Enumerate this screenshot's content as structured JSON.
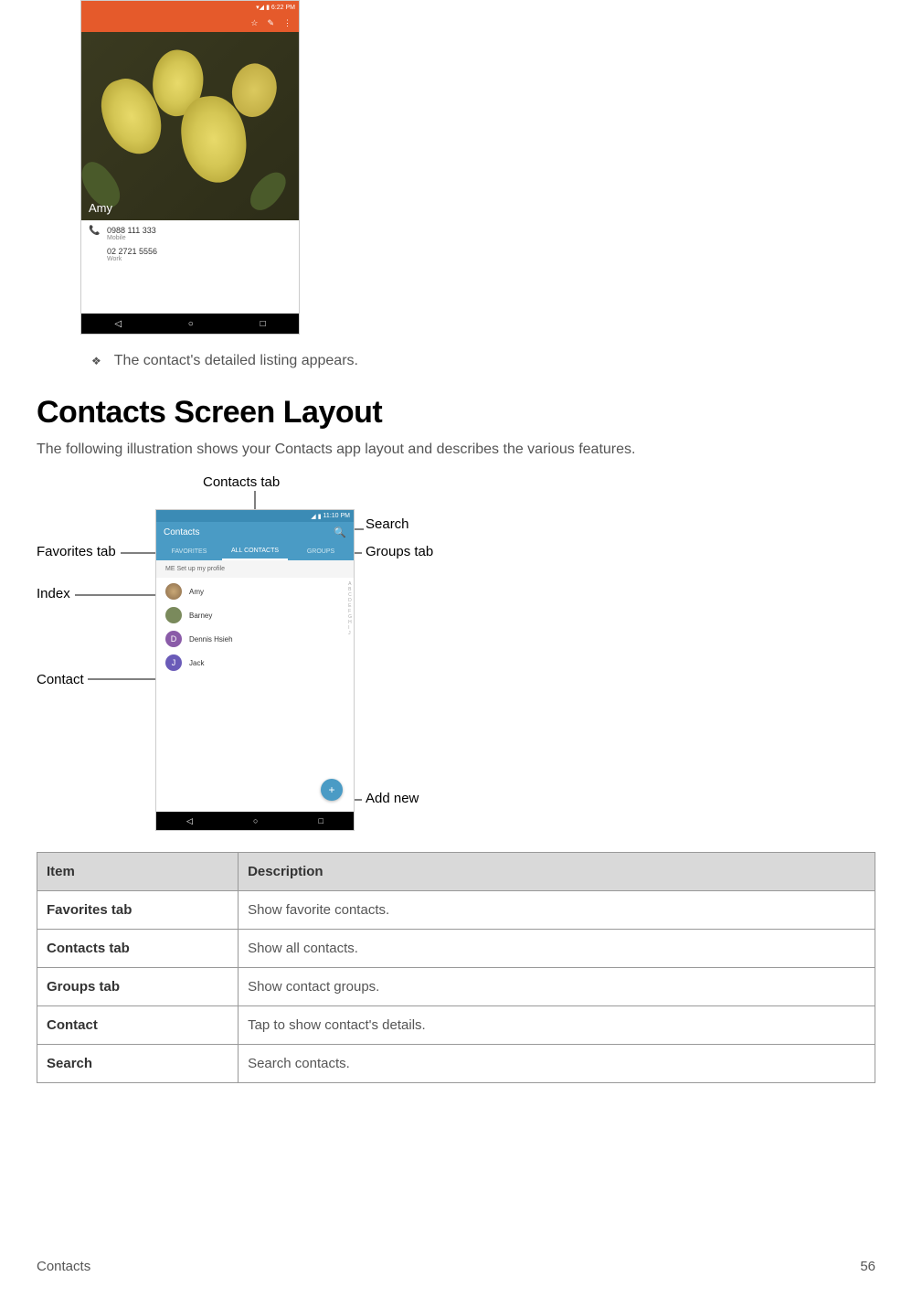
{
  "phone1": {
    "status_time": "6:22 PM",
    "icons": [
      "star",
      "edit",
      "more"
    ],
    "contact_name": "Amy",
    "entries": [
      {
        "number": "0988 111 333",
        "label": "Mobile"
      },
      {
        "number": "02 2721 5556",
        "label": "Work"
      }
    ]
  },
  "bullet_text": "The contact's detailed listing appears.",
  "heading": "Contacts Screen Layout",
  "intro": "The following illustration shows your Contacts app layout and describes the various features.",
  "figure": {
    "status_time": "11:10 PM",
    "header_title": "Contacts",
    "search_icon_name": "search",
    "tabs": {
      "fav": "FAVORITES",
      "all": "ALL CONTACTS",
      "grp": "GROUPS"
    },
    "me_row": "ME    Set up my profile",
    "contacts": [
      "Amy",
      "Barney",
      "Dennis Hsieh",
      "Jack"
    ],
    "index_letters": [
      "A",
      "B",
      "C",
      "D",
      "E",
      "F",
      "G",
      "H",
      "I",
      "J"
    ],
    "callouts": {
      "contacts_tab": "Contacts tab",
      "search": "Search",
      "favorites_tab": "Favorites tab",
      "groups_tab": "Groups tab",
      "index": "Index",
      "contact": "Contact",
      "add_new": "Add new"
    }
  },
  "table": {
    "headers": {
      "item": "Item",
      "desc": "Description"
    },
    "rows": [
      {
        "item": "Favorites tab",
        "desc": "Show favorite contacts."
      },
      {
        "item": "Contacts tab",
        "desc": "Show all contacts."
      },
      {
        "item": "Groups tab",
        "desc": "Show contact groups."
      },
      {
        "item": "Contact",
        "desc": "Tap to show contact's details."
      },
      {
        "item": "Search",
        "desc": "Search contacts."
      }
    ]
  },
  "footer": {
    "left": "Contacts",
    "right": "56"
  }
}
